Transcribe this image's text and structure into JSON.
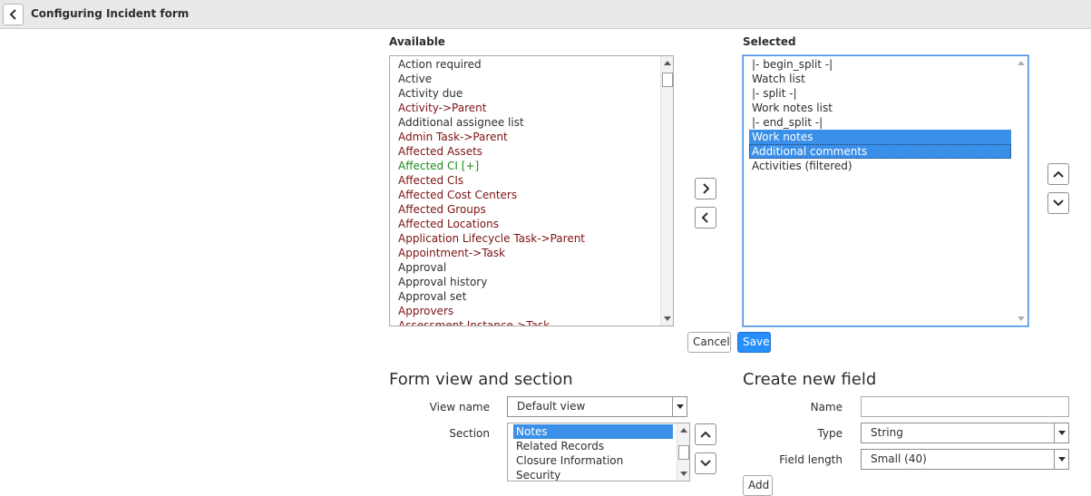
{
  "header": {
    "title": "Configuring Incident form"
  },
  "available": {
    "label": "Available",
    "items": [
      {
        "text": "Action required",
        "kind": "field"
      },
      {
        "text": "Active",
        "kind": "field"
      },
      {
        "text": "Activity due",
        "kind": "field"
      },
      {
        "text": "Activity->Parent",
        "kind": "ref"
      },
      {
        "text": "Additional assignee list",
        "kind": "field"
      },
      {
        "text": "Admin Task->Parent",
        "kind": "ref"
      },
      {
        "text": "Affected Assets",
        "kind": "ref"
      },
      {
        "text": "Affected CI [+]",
        "kind": "green"
      },
      {
        "text": "Affected CIs",
        "kind": "ref"
      },
      {
        "text": "Affected Cost Centers",
        "kind": "ref"
      },
      {
        "text": "Affected Groups",
        "kind": "ref"
      },
      {
        "text": "Affected Locations",
        "kind": "ref"
      },
      {
        "text": "Application Lifecycle Task->Parent",
        "kind": "ref"
      },
      {
        "text": "Appointment->Task",
        "kind": "ref"
      },
      {
        "text": "Approval",
        "kind": "field"
      },
      {
        "text": "Approval history",
        "kind": "field"
      },
      {
        "text": "Approval set",
        "kind": "field"
      },
      {
        "text": "Approvers",
        "kind": "ref"
      },
      {
        "text": "Assessment Instance->Task",
        "kind": "ref"
      }
    ]
  },
  "selected": {
    "label": "Selected",
    "items": [
      {
        "text": "|- begin_split -|",
        "selected": false
      },
      {
        "text": "Watch list",
        "selected": false
      },
      {
        "text": "|- split -|",
        "selected": false
      },
      {
        "text": "Work notes list",
        "selected": false
      },
      {
        "text": "|- end_split -|",
        "selected": false
      },
      {
        "text": "Work notes",
        "selected": true
      },
      {
        "text": "Additional comments",
        "selected": true
      },
      {
        "text": "Activities (filtered)",
        "selected": false
      }
    ]
  },
  "actions": {
    "cancel_label": "Cancel",
    "save_label": "Save"
  },
  "form_view": {
    "title": "Form view and section",
    "view_name_label": "View name",
    "view_name_value": "Default view",
    "section_label": "Section",
    "sections": [
      {
        "text": "Notes",
        "selected": true
      },
      {
        "text": "Related Records",
        "selected": false
      },
      {
        "text": "Closure Information",
        "selected": false
      },
      {
        "text": "Security",
        "selected": false
      }
    ]
  },
  "new_field": {
    "title": "Create new field",
    "name_label": "Name",
    "name_value": "",
    "type_label": "Type",
    "type_value": "String",
    "length_label": "Field length",
    "length_value": "Small (40)",
    "add_label": "Add"
  },
  "colors": {
    "reference": "#7d1212",
    "green": "#1e8a1e",
    "highlight": "#3a8fe8",
    "primary": "#278efc"
  }
}
